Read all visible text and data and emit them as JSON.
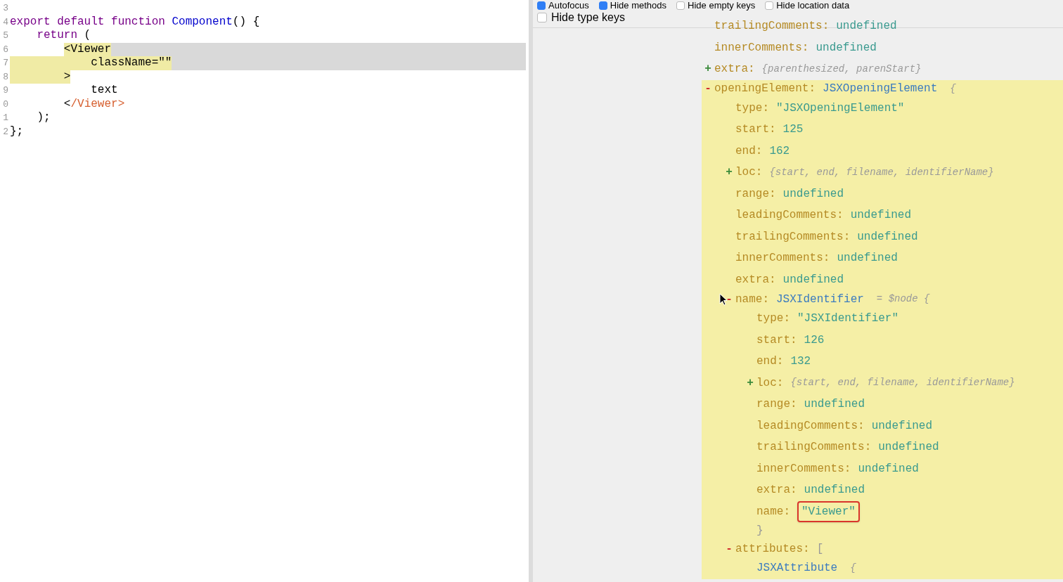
{
  "editor": {
    "lines": [
      {
        "number": "3",
        "selected": false
      },
      {
        "number": "4",
        "selected": false,
        "tokens": [
          {
            "text": "export default function ",
            "kind": "keyword",
            "marked": false
          },
          {
            "text": "Component",
            "kind": "def",
            "marked": false
          },
          {
            "text": "() {",
            "kind": "plain",
            "marked": false
          }
        ]
      },
      {
        "number": "5",
        "selected": false,
        "tokens": [
          {
            "text": "    return",
            "kind": "keyword",
            "marked": false
          },
          {
            "text": " (",
            "kind": "plain",
            "marked": false
          }
        ]
      },
      {
        "number": "6",
        "selected": true,
        "tokens": [
          {
            "text": "        <Viewer",
            "kind": "plain",
            "marked": true
          }
        ]
      },
      {
        "number": "7",
        "selected": true,
        "tokens": [
          {
            "text": "            className=\"\"",
            "kind": "plain",
            "marked": true
          }
        ]
      },
      {
        "number": "8",
        "selected": false,
        "tokens": [
          {
            "text": "        >",
            "kind": "plain",
            "marked": true
          }
        ]
      },
      {
        "number": "9",
        "selected": false,
        "tokens": [
          {
            "text": "            text",
            "kind": "plain",
            "marked": false
          }
        ]
      },
      {
        "number": "0",
        "selected": false,
        "tokens": [
          {
            "text": "        <",
            "kind": "plain",
            "marked": false
          },
          {
            "text": "/Viewer>",
            "kind": "tag",
            "marked": false
          }
        ]
      },
      {
        "number": "1",
        "selected": false,
        "tokens": [
          {
            "text": "    );",
            "kind": "plain",
            "marked": false
          }
        ]
      },
      {
        "number": "2",
        "selected": false,
        "tokens": [
          {
            "text": "};",
            "kind": "plain",
            "marked": false
          }
        ]
      }
    ]
  },
  "options": [
    {
      "label": "Autofocus",
      "checked": true
    },
    {
      "label": "Hide methods",
      "checked": true
    },
    {
      "label": "Hide empty keys",
      "checked": false
    },
    {
      "label": "Hide location data",
      "checked": false
    },
    {
      "label": "Hide type keys",
      "checked": false
    }
  ],
  "tree": [
    {
      "key": "trailingComments:",
      "value": "undefined",
      "kind": "plain"
    },
    {
      "key": "innerComments:",
      "value": "undefined",
      "kind": "plain"
    },
    {
      "toggle": "+",
      "key": "extra:",
      "value": "{parenthesized, parenStart}",
      "kind": "summary",
      "expanded": false
    },
    {
      "toggle": "-",
      "key": "openingElement:",
      "value": "JSXOpeningElement",
      "kind": "type",
      "suffix": "{",
      "expanded": true,
      "highlighted": true,
      "children": [
        {
          "key": "type:",
          "value": "\"JSXOpeningElement\"",
          "kind": "plain"
        },
        {
          "key": "start:",
          "value": "125",
          "kind": "plain"
        },
        {
          "key": "end:",
          "value": "162",
          "kind": "plain"
        },
        {
          "toggle": "+",
          "key": "loc:",
          "value": "{start, end, filename, identifierName}",
          "kind": "summary",
          "expanded": false
        },
        {
          "key": "range:",
          "value": "undefined",
          "kind": "plain"
        },
        {
          "key": "leadingComments:",
          "value": "undefined",
          "kind": "plain"
        },
        {
          "key": "trailingComments:",
          "value": "undefined",
          "kind": "plain"
        },
        {
          "key": "innerComments:",
          "value": "undefined",
          "kind": "plain"
        },
        {
          "key": "extra:",
          "value": "undefined",
          "kind": "plain"
        },
        {
          "toggle": "-",
          "key": "name:",
          "value": "JSXIdentifier",
          "kind": "type",
          "suffix": "= $node {",
          "expanded": true,
          "close": "}",
          "children": [
            {
              "key": "type:",
              "value": "\"JSXIdentifier\"",
              "kind": "plain"
            },
            {
              "key": "start:",
              "value": "126",
              "kind": "plain"
            },
            {
              "key": "end:",
              "value": "132",
              "kind": "plain"
            },
            {
              "toggle": "+",
              "key": "loc:",
              "value": "{start, end, filename, identifierName}",
              "kind": "summary",
              "expanded": false
            },
            {
              "key": "range:",
              "value": "undefined",
              "kind": "plain"
            },
            {
              "key": "leadingComments:",
              "value": "undefined",
              "kind": "plain"
            },
            {
              "key": "trailingComments:",
              "value": "undefined",
              "kind": "plain"
            },
            {
              "key": "innerComments:",
              "value": "undefined",
              "kind": "plain"
            },
            {
              "key": "extra:",
              "value": "undefined",
              "kind": "plain"
            },
            {
              "key": "name:",
              "value": "\"Viewer\"",
              "kind": "plain",
              "boxed": true
            }
          ]
        },
        {
          "toggle": "-",
          "key": "attributes:",
          "value": "[",
          "kind": "bracket",
          "expanded": true,
          "children": [
            {
              "value": "JSXAttribute",
              "kind": "type",
              "suffix": "{"
            }
          ]
        }
      ]
    }
  ]
}
